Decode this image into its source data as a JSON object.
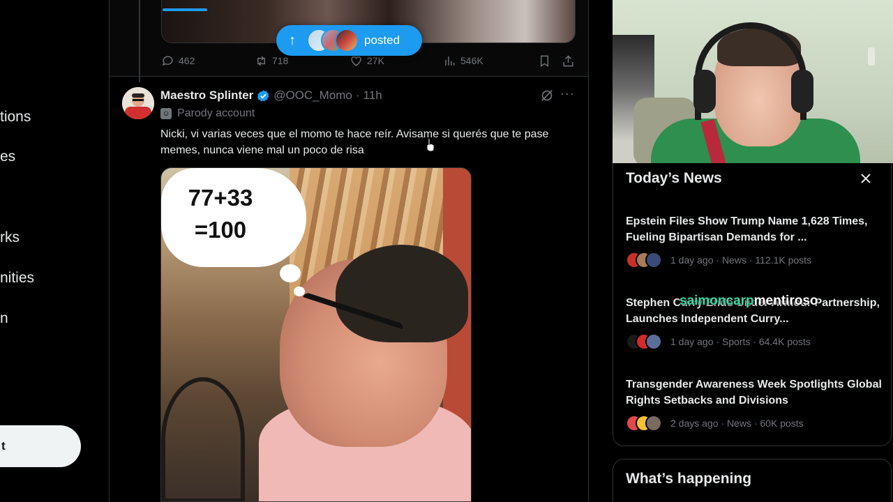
{
  "sidebar": {
    "items": [
      {
        "label": "tions"
      },
      {
        "label": "es"
      },
      {
        "label": "rks"
      },
      {
        "label": "nities"
      },
      {
        "label": "n"
      }
    ],
    "post_button": "t"
  },
  "top_tweet": {
    "replies": "462",
    "reposts": "718",
    "likes": "27K",
    "views": "546K"
  },
  "posted_pill": {
    "label": "posted"
  },
  "tweet": {
    "name": "Maestro Splinter",
    "handle": "@OOC_Momo",
    "dot": "·",
    "time": "11h",
    "more": "···",
    "parody_label": "Parody account",
    "text": "Nicki, vi varias veces que el momo te hace reír. Avisame si querés que te pase memes, nunca viene mal un poco de risa",
    "image_caption": "77+33\n=100"
  },
  "news": {
    "title": "Today’s News",
    "items": [
      {
        "headline": "Epstein Files Show Trump Name 1,628 Times, Fueling Bipartisan Demands for ...",
        "meta": "1 day ago · News · 112.1K posts"
      },
      {
        "headline": "Stephen Curry Ends Under Armour Partnership, Launches Independent Curry...",
        "meta": "1 day ago · Sports · 64.4K posts"
      },
      {
        "headline": "Transgender Awareness Week Spotlights Global Rights Setbacks and Divisions",
        "meta": "2 days ago · News · 60K posts"
      }
    ]
  },
  "chat_overlay": {
    "user": "saimoncarp",
    "message": "mentiroso"
  },
  "happening": {
    "title": "What’s happening"
  },
  "colors": {
    "accent": "#1d9bf0",
    "background": "#000000",
    "muted_text": "#71767b",
    "chat_user": "#3ed6a2"
  }
}
